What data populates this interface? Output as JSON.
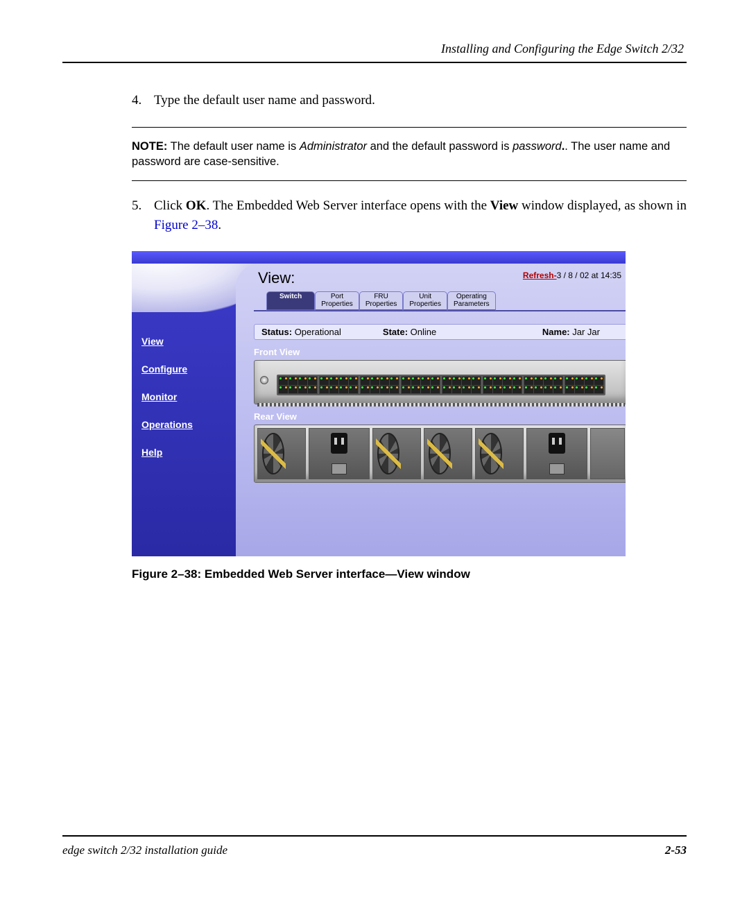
{
  "header": {
    "running_title": "Installing and Configuring the Edge Switch 2/32"
  },
  "steps": {
    "s4": {
      "num": "4.",
      "text": "Type the default user name and password."
    },
    "s5": {
      "num": "5.",
      "pre": "Click ",
      "bold1": "OK",
      "mid1": ". The Embedded Web Server interface opens with the ",
      "bold2": "View",
      "mid2": " window displayed, as shown in ",
      "link": "Figure 2–38",
      "post": "."
    }
  },
  "note": {
    "label": "NOTE:",
    "t1": "  The default user name is ",
    "i1": "Administrator",
    "t2": " and the default password is ",
    "i2": "password",
    "t3": ". The user name and password are case-sensitive."
  },
  "ui": {
    "view_label": "View:",
    "refresh_label": "Refresh-",
    "refresh_ts": "3 / 8 / 02 at 14:35",
    "sidebar": {
      "view": "View",
      "configure": "Configure",
      "monitor": "Monitor",
      "operations": "Operations",
      "help": "Help"
    },
    "tabs": {
      "switch": "Switch",
      "port": "Port\nProperties",
      "fru": "FRU\nProperties",
      "unit": "Unit\nProperties",
      "oper": "Operating\nParameters"
    },
    "status": {
      "status_l": "Status:",
      "status_v": "Operational",
      "state_l": "State:",
      "state_v": "Online",
      "name_l": "Name:",
      "name_v": "Jar Jar"
    },
    "front_label": "Front View",
    "rear_label": "Rear View"
  },
  "caption": "Figure 2–38:  Embedded Web Server interface—View window",
  "footer": {
    "guide": "edge switch 2/32 installation guide",
    "page": "2-53"
  }
}
